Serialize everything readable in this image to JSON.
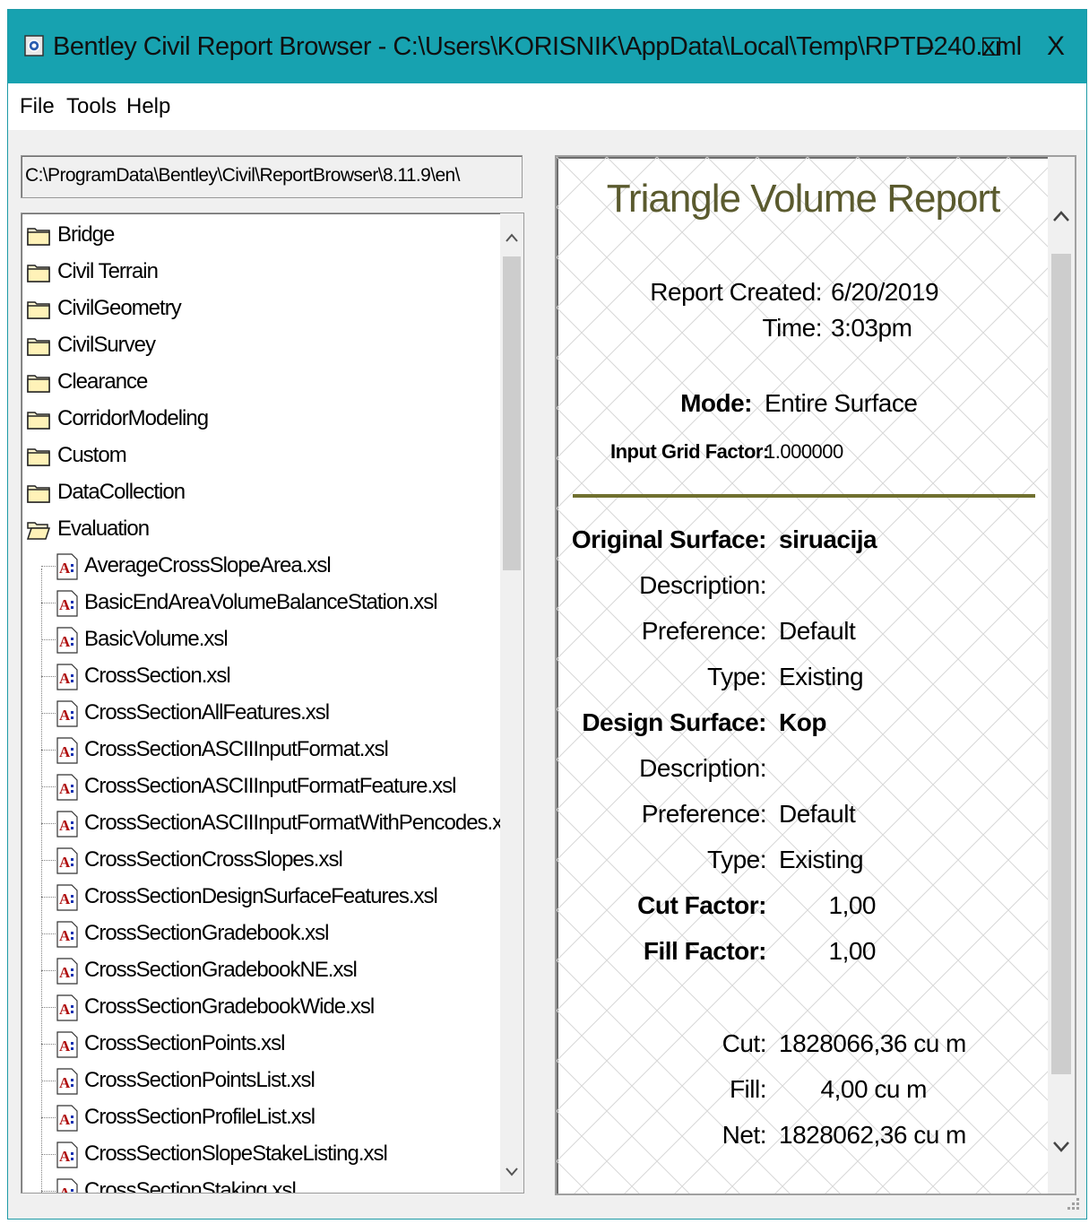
{
  "window": {
    "title": "Bentley Civil Report Browser - C:\\Users\\KORISNIK\\AppData\\Local\\Temp\\RPTD240.xml",
    "controls": {
      "minimize": "–",
      "maximize": "☐",
      "close": "X"
    }
  },
  "menu": {
    "file": "File",
    "tools": "Tools",
    "help": "Help"
  },
  "path": "C:\\ProgramData\\Bentley\\Civil\\ReportBrowser\\8.11.9\\en\\",
  "tree": {
    "folders": [
      "Bridge",
      "Civil Terrain",
      "CivilGeometry",
      "CivilSurvey",
      "Clearance",
      "CorridorModeling",
      "Custom",
      "DataCollection",
      "Evaluation"
    ],
    "files": [
      "AverageCrossSlopeArea.xsl",
      "BasicEndAreaVolumeBalanceStation.xsl",
      "BasicVolume.xsl",
      "CrossSection.xsl",
      "CrossSectionAllFeatures.xsl",
      "CrossSectionASCIIInputFormat.xsl",
      "CrossSectionASCIIInputFormatFeature.xsl",
      "CrossSectionASCIIInputFormatWithPencodes.xsl",
      "CrossSectionCrossSlopes.xsl",
      "CrossSectionDesignSurfaceFeatures.xsl",
      "CrossSectionGradebook.xsl",
      "CrossSectionGradebookNE.xsl",
      "CrossSectionGradebookWide.xsl",
      "CrossSectionPoints.xsl",
      "CrossSectionPointsList.xsl",
      "CrossSectionProfileList.xsl",
      "CrossSectionSlopeStakeListing.xsl",
      "CrossSectionStaking.xsl"
    ],
    "file_icon_glyph": "A:"
  },
  "report": {
    "title": "Triangle Volume Report",
    "created_label": "Report Created:",
    "created_value": "6/20/2019",
    "time_label": "Time:",
    "time_value": "3:03pm",
    "mode_label": "Mode:",
    "mode_value": "Entire Surface",
    "grid_label": "Input Grid Factor:",
    "grid_value": "1.000000",
    "original_label": "Original Surface:",
    "original_value": "siruacija",
    "description_label": "Description:",
    "preference_label": "Preference:",
    "preference_value": "Default",
    "type_label": "Type:",
    "type_value": "Existing",
    "design_label": "Design Surface:",
    "design_value": "Kop",
    "cut_factor_label": "Cut Factor:",
    "cut_factor_value": "1,00",
    "fill_factor_label": "Fill Factor:",
    "fill_factor_value": "1,00",
    "cut_label": "Cut:",
    "cut_value": "1828066,36 cu m",
    "fill_label": "Fill:",
    "fill_value": "4,00 cu m",
    "net_label": "Net:",
    "net_value": "1828062,36 cu m"
  },
  "colors": {
    "titlebar": "#17a2b0",
    "report_title": "#5a5a2e",
    "divider": "#70702f"
  }
}
